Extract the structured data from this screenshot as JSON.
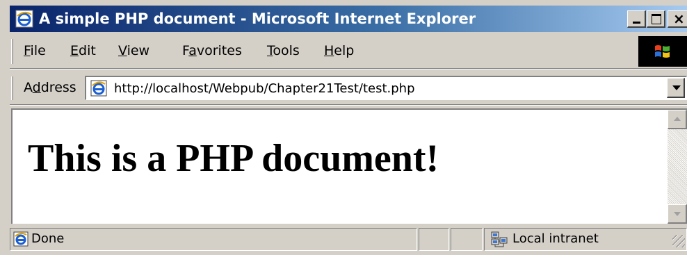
{
  "window": {
    "title": "A simple PHP document - Microsoft Internet Explorer",
    "icon": "ie-icon",
    "controls": {
      "minimize": "minimize-icon",
      "maximize": "maximize-icon",
      "close": "close-icon",
      "close_glyph": "×"
    }
  },
  "menu": {
    "items": [
      {
        "underline": "F",
        "rest": "ile"
      },
      {
        "underline": "E",
        "rest": "dit"
      },
      {
        "underline": "V",
        "rest": "iew"
      },
      {
        "pre": "F",
        "underline": "a",
        "rest": "vorites"
      },
      {
        "underline": "T",
        "rest": "ools"
      },
      {
        "underline": "H",
        "rest": "elp"
      }
    ],
    "throbber_icon": "windows-logo-icon"
  },
  "address": {
    "label_pre": "A",
    "label_underline": "d",
    "label_rest": "dress",
    "url": "http://localhost/Webpub/Chapter21Test/test.php",
    "page_icon": "ie-page-icon"
  },
  "page": {
    "heading": "This is a PHP document!"
  },
  "status": {
    "text": "Done",
    "zone": "Local intranet",
    "zone_icon": "local-intranet-icon"
  },
  "colors": {
    "title_gradient_start": "#0a246a",
    "title_gradient_end": "#a6caf0",
    "chrome": "#d4d0c8"
  }
}
